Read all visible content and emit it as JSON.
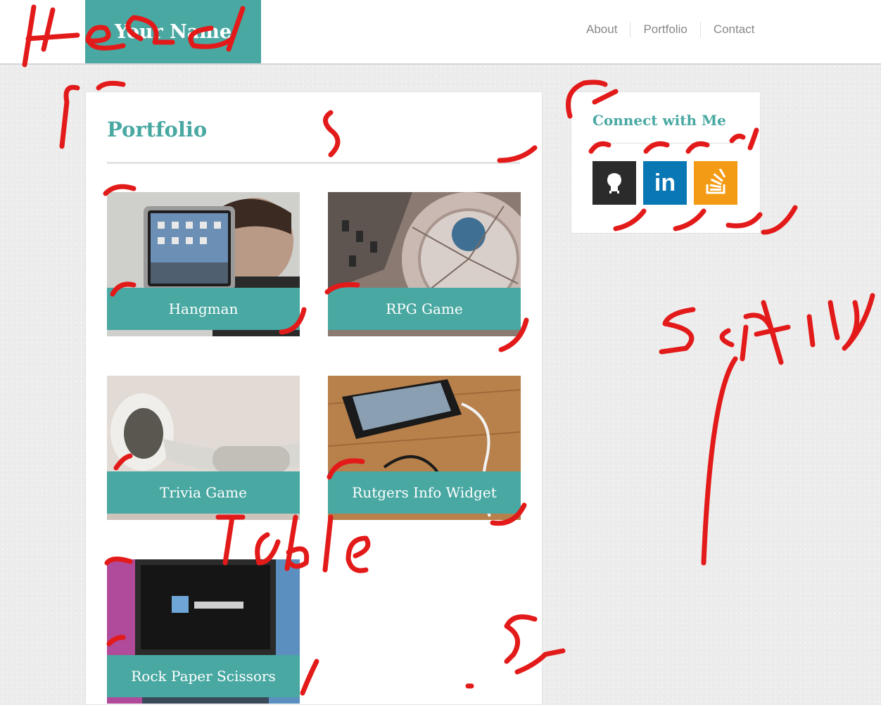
{
  "header": {
    "logo_text": "Your Name",
    "nav": [
      "About",
      "Portfolio",
      "Contact"
    ]
  },
  "main": {
    "title": "Portfolio",
    "projects": [
      {
        "label": "Hangman"
      },
      {
        "label": "RPG Game"
      },
      {
        "label": "Trivia Game"
      },
      {
        "label": "Rutgers Info Widget"
      },
      {
        "label": "Rock Paper Scissors"
      }
    ]
  },
  "sidebar": {
    "title": "Connect with Me",
    "social": [
      {
        "icon": "github-icon",
        "color": "#2b2b2b"
      },
      {
        "icon": "linkedin-icon",
        "color": "#0a77b5",
        "glyph": "in"
      },
      {
        "icon": "stackoverflow-icon",
        "color": "#f49b15"
      }
    ]
  },
  "annotations": {
    "color": "#e31a1a",
    "labels": [
      "Head",
      "Sortin",
      "Table"
    ]
  },
  "colors": {
    "accent": "#49a8a2"
  }
}
